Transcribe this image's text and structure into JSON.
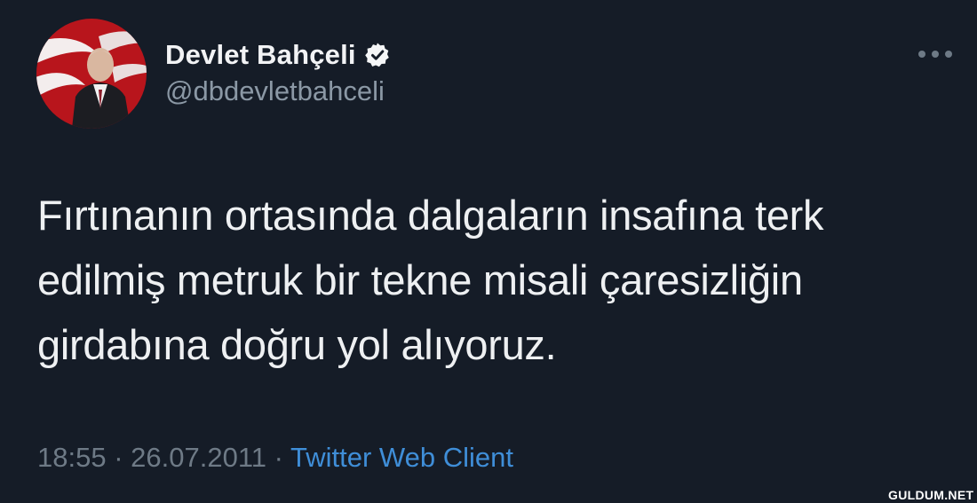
{
  "user": {
    "display_name": "Devlet Bahçeli",
    "handle": "@dbdevletbahceli",
    "verified": true
  },
  "tweet": {
    "text": "Fırtınanın ortasında dalgaların insafına terk\nedilmiş metruk bir tekne misali çaresizliğin\ngirdabına doğru yol alıyoruz.",
    "time": "18:55",
    "separator": "·",
    "date": "26.07.2011",
    "source": "Twitter Web Client"
  },
  "watermark": "GULDUM.NET",
  "colors": {
    "background": "#151c27",
    "name": "#f2f3f5",
    "muted": "#8b98a5",
    "link": "#3f8ed8"
  },
  "icons": {
    "verified": "verified-badge-icon",
    "more": "more-options-icon"
  }
}
